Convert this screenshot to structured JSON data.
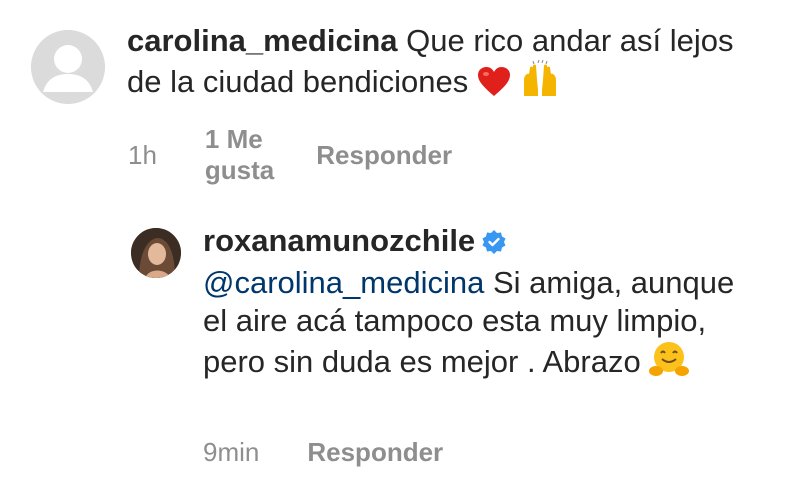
{
  "comments": [
    {
      "username": "carolina_medicina",
      "text": "Que rico andar así lejos de la ciudad bendiciones",
      "emojis": [
        "red-heart-icon",
        "raising-hands-icon"
      ],
      "time": "1h",
      "likes": "1 Me gusta",
      "reply_label": "Responder"
    },
    {
      "username": "roxanamunozchile",
      "verified": true,
      "mention": "@carolina_medicina",
      "text": "Si amiga, aunque el aire acá tampoco esta muy limpio, pero sin duda es mejor . Abrazo",
      "emojis": [
        "hugging-face-icon"
      ],
      "time": "9min",
      "reply_label": "Responder"
    }
  ],
  "colors": {
    "mention": "#00376b",
    "meta": "#8e8e8e",
    "verified": "#3897f0"
  }
}
